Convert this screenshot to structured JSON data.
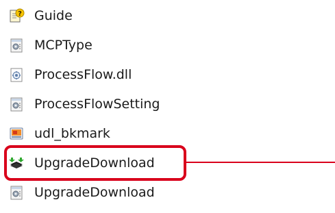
{
  "files": [
    {
      "name": "Guide",
      "icon": "help-document-icon"
    },
    {
      "name": "MCPType",
      "icon": "config-settings-file-icon"
    },
    {
      "name": "ProcessFlow.dll",
      "icon": "dll-file-icon"
    },
    {
      "name": "ProcessFlowSetting",
      "icon": "config-settings-file-icon"
    },
    {
      "name": "udl_bkmark",
      "icon": "data-link-file-icon"
    },
    {
      "name": "UpgradeDownload",
      "icon": "upgrade-download-app-icon"
    },
    {
      "name": "UpgradeDownload",
      "icon": "config-settings-file-icon"
    }
  ],
  "highlight": {
    "target_index": 5,
    "color": "#d9001b"
  }
}
